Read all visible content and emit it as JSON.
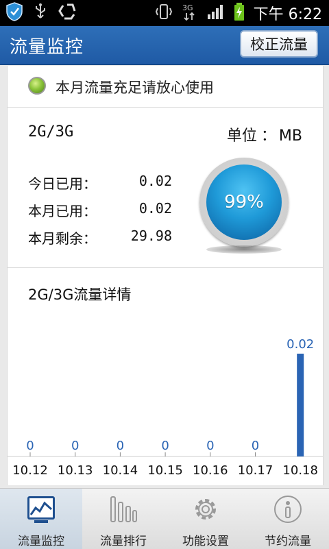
{
  "status_bar": {
    "time": "下午 6:22",
    "network": "3G"
  },
  "header": {
    "title": "流量监控",
    "calibrate_label": "校正流量"
  },
  "notice": {
    "text": "本月流量充足请放心使用"
  },
  "summary": {
    "network_type": "2G/3G",
    "unit_label": "单位",
    "unit_sep": "：",
    "unit_value": "MB",
    "rows": [
      {
        "label": "今日已用：",
        "value": "0.02"
      },
      {
        "label": "本月已用：",
        "value": "0.02"
      },
      {
        "label": "本月剩余：",
        "value": "29.98"
      }
    ],
    "gauge_percent": "99%"
  },
  "details": {
    "title": "2G/3G流量详情"
  },
  "chart_data": {
    "type": "bar",
    "categories": [
      "10.12",
      "10.13",
      "10.14",
      "10.15",
      "10.16",
      "10.17",
      "10.18"
    ],
    "values": [
      0,
      0,
      0,
      0,
      0,
      0,
      0.02
    ],
    "value_labels": [
      "0",
      "0",
      "0",
      "0",
      "0",
      "0",
      "0.02"
    ],
    "bar_color": "#2a64b4",
    "ylim": [
      0,
      0.02
    ]
  },
  "nav": {
    "items": [
      {
        "label": "流量监控",
        "icon": "monitor-chart-icon",
        "active": true
      },
      {
        "label": "流量排行",
        "icon": "ranking-bars-icon",
        "active": false
      },
      {
        "label": "功能设置",
        "icon": "gear-icon",
        "active": false
      },
      {
        "label": "节约流量",
        "icon": "info-icon",
        "active": false
      }
    ]
  },
  "colors": {
    "accent": "#1f5aa5",
    "bar": "#2a64b4",
    "led": "#8bc43a",
    "gauge": "#1f9ad8"
  }
}
